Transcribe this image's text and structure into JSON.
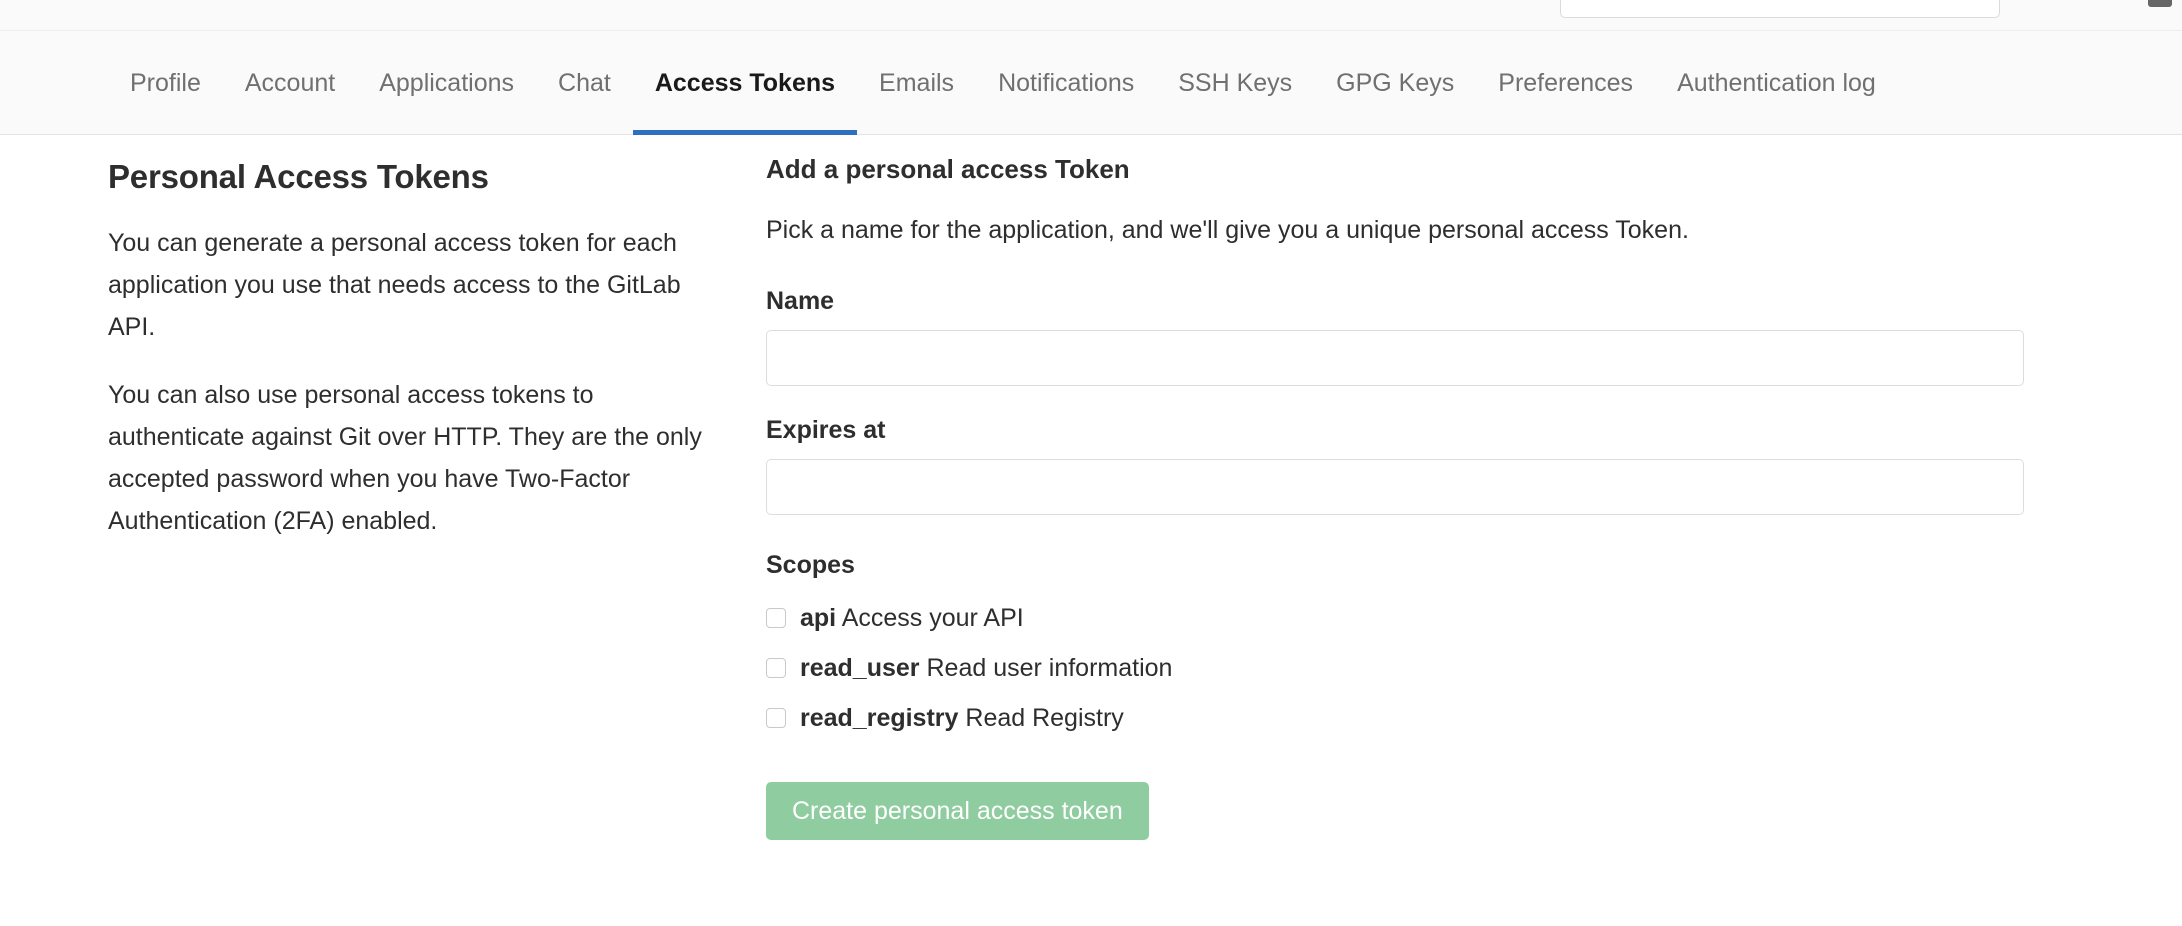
{
  "colors": {
    "accent": "#2f6fc0",
    "button_green": "#8fcc9f",
    "nav_background": "#fafafa",
    "page_background": "#ffffff"
  },
  "top_bar": {
    "search_placeholder": "",
    "search_value": ""
  },
  "nav": {
    "tabs": [
      {
        "label": "Profile",
        "active": false
      },
      {
        "label": "Account",
        "active": false
      },
      {
        "label": "Applications",
        "active": false
      },
      {
        "label": "Chat",
        "active": false
      },
      {
        "label": "Access Tokens",
        "active": true
      },
      {
        "label": "Emails",
        "active": false
      },
      {
        "label": "Notifications",
        "active": false
      },
      {
        "label": "SSH Keys",
        "active": false
      },
      {
        "label": "GPG Keys",
        "active": false
      },
      {
        "label": "Preferences",
        "active": false
      },
      {
        "label": "Authentication log",
        "active": false
      }
    ]
  },
  "info": {
    "title": "Personal Access Tokens",
    "paragraph_1": "You can generate a personal access token for each application you use that needs access to the GitLab API.",
    "paragraph_2": "You can also use personal access tokens to authenticate against Git over HTTP. They are the only accepted password when you have Two-Factor Authentication (2FA) enabled."
  },
  "form": {
    "title": "Add a personal access Token",
    "lead": "Pick a name for the application, and we'll give you a unique personal access Token.",
    "name": {
      "label": "Name",
      "value": "",
      "placeholder": ""
    },
    "expires_at": {
      "label": "Expires at",
      "value": "",
      "placeholder": ""
    },
    "scopes": {
      "label": "Scopes",
      "items": [
        {
          "key": "api",
          "description": "Access your API",
          "checked": false
        },
        {
          "key": "read_user",
          "description": "Read user information",
          "checked": false
        },
        {
          "key": "read_registry",
          "description": "Read Registry",
          "checked": false
        }
      ]
    },
    "submit_label": "Create personal access token"
  }
}
